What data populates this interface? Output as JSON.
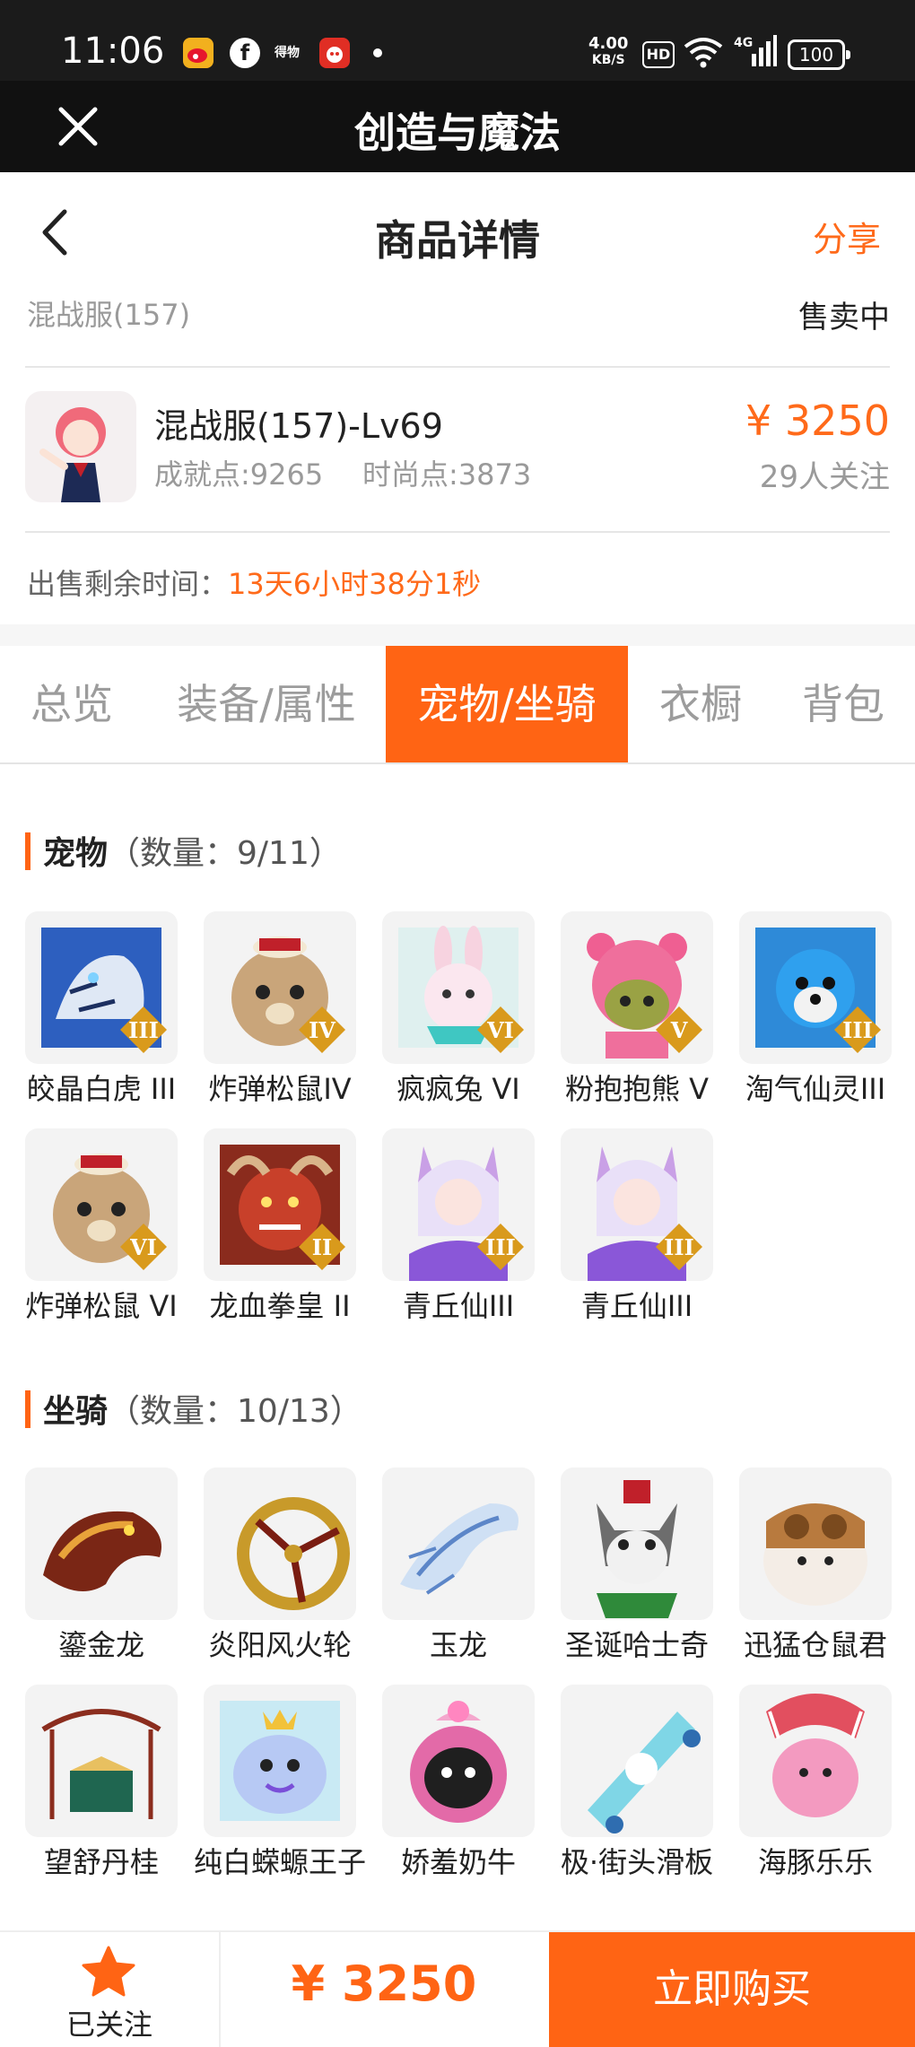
{
  "status_bar": {
    "time": "11:06",
    "apps": [
      "weibo-icon",
      "facebook-icon",
      "dewu-icon",
      "pinduoduo-icon"
    ],
    "dewu_text": "得物",
    "speed": "4.00",
    "speed_unit": "KB/S",
    "hd": "HD",
    "network": "4G",
    "battery": "100"
  },
  "app_bar": {
    "title": "创造与魔法"
  },
  "header": {
    "title": "商品详情",
    "share": "分享"
  },
  "server": {
    "name": "混战服(157)",
    "status": "售卖中"
  },
  "account": {
    "name": "混战服(157)-Lv69",
    "achievement": "成就点:9265",
    "fashion": "时尚点:3873",
    "price": "¥ 3250",
    "followers": "29人关注"
  },
  "remaining": {
    "label": "出售剩余时间：",
    "value": "13天6小时38分1秒"
  },
  "tabs": [
    "总览",
    "装备/属性",
    "宠物/坐骑",
    "衣橱",
    "背包"
  ],
  "active_tab": "宠物/坐骑",
  "pets": {
    "title": "宠物",
    "count": "（数量：9/11）",
    "items": [
      {
        "label": "皎晶白虎 III",
        "rank": "III"
      },
      {
        "label": "炸弹松鼠IV",
        "rank": "IV"
      },
      {
        "label": "疯疯兔 VI",
        "rank": "VI"
      },
      {
        "label": "粉抱抱熊 V",
        "rank": "V"
      },
      {
        "label": "淘气仙灵III",
        "rank": "III"
      },
      {
        "label": "炸弹松鼠 VI",
        "rank": "VI"
      },
      {
        "label": "龙血拳皇 II",
        "rank": "II"
      },
      {
        "label": "青丘仙III",
        "rank": "III"
      },
      {
        "label": "青丘仙III",
        "rank": "III"
      }
    ]
  },
  "mounts": {
    "title": "坐骑",
    "count": "（数量：10/13）",
    "items": [
      {
        "label": "鎏金龙"
      },
      {
        "label": "炎阳风火轮"
      },
      {
        "label": "玉龙"
      },
      {
        "label": "圣诞哈士奇"
      },
      {
        "label": "迅猛仓鼠君"
      },
      {
        "label": "望舒丹桂"
      },
      {
        "label": "纯白蝾螈王子"
      },
      {
        "label": "娇羞奶牛"
      },
      {
        "label": "极·街头滑板"
      },
      {
        "label": "海豚乐乐"
      }
    ]
  },
  "bottom": {
    "follow_label": "已关注",
    "price": "¥ 3250",
    "buy_label": "立即购买"
  },
  "colors": {
    "accent": "#ff6414",
    "dark_bar": "#111111"
  }
}
